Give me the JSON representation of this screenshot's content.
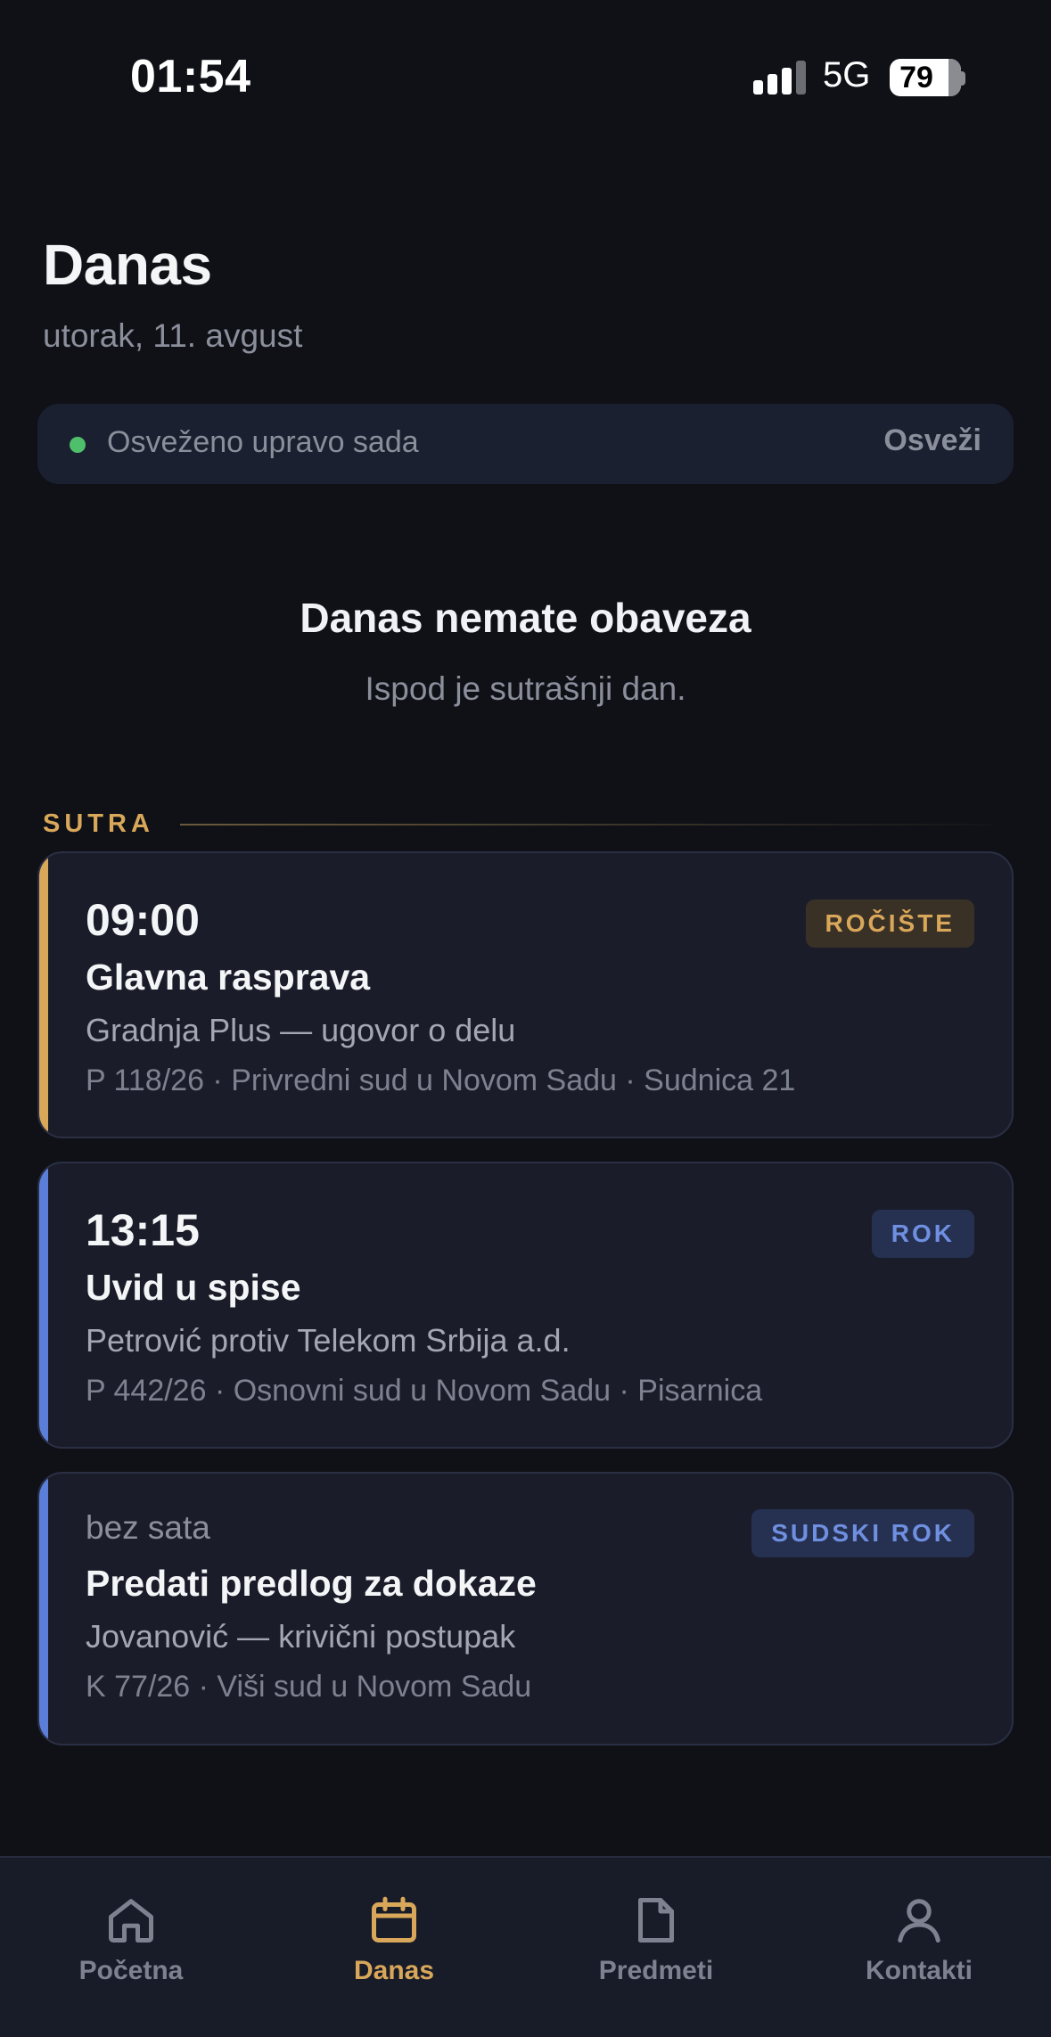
{
  "status_bar": {
    "time": "01:54",
    "network": "5G",
    "battery": "79"
  },
  "header": {
    "title": "Danas",
    "date": "utorak, 11. avgust"
  },
  "refresh": {
    "label": "Osveženo upravo sada",
    "button": "Osveži",
    "dot_color": "#4fbf6b"
  },
  "empty_state": {
    "title": "Danas nemate obaveza",
    "subtitle": "Ispod je sutrašnji dan."
  },
  "section": {
    "label": "SUTRA"
  },
  "events": [
    {
      "time": "09:00",
      "title": "Glavna rasprava",
      "subtitle": "Gradnja Plus — ugovor o delu",
      "meta": "P 118/26 · Privredni sud u Novom Sadu · Sudnica 21",
      "badge": "ROČIŠTE",
      "accent": "#d9a75a"
    },
    {
      "time": "13:15",
      "title": "Uvid u spise",
      "subtitle": "Petrović protiv Telekom Srbija a.d.",
      "meta": "P 442/26 · Osnovni sud u Novom Sadu · Pisarnica",
      "badge": "ROK",
      "accent": "#5b7fd9"
    },
    {
      "time": "bez sata",
      "title": "Predati predlog za dokaze",
      "subtitle": "Jovanović — krivični postupak",
      "meta": "K 77/26 · Viši sud u Novom Sadu",
      "badge": "SUDSKI ROK",
      "accent": "#5b7fd9"
    }
  ],
  "tabs": [
    {
      "label": "Početna",
      "icon": "home-icon",
      "active": false
    },
    {
      "label": "Danas",
      "icon": "calendar-icon",
      "active": true
    },
    {
      "label": "Predmeti",
      "icon": "document-icon",
      "active": false
    },
    {
      "label": "Kontakti",
      "icon": "person-icon",
      "active": false
    }
  ],
  "colors": {
    "background": "#0f1117",
    "card": "#1a1d29",
    "accent_gold": "#d9a75a",
    "accent_blue": "#5b7fd9"
  }
}
